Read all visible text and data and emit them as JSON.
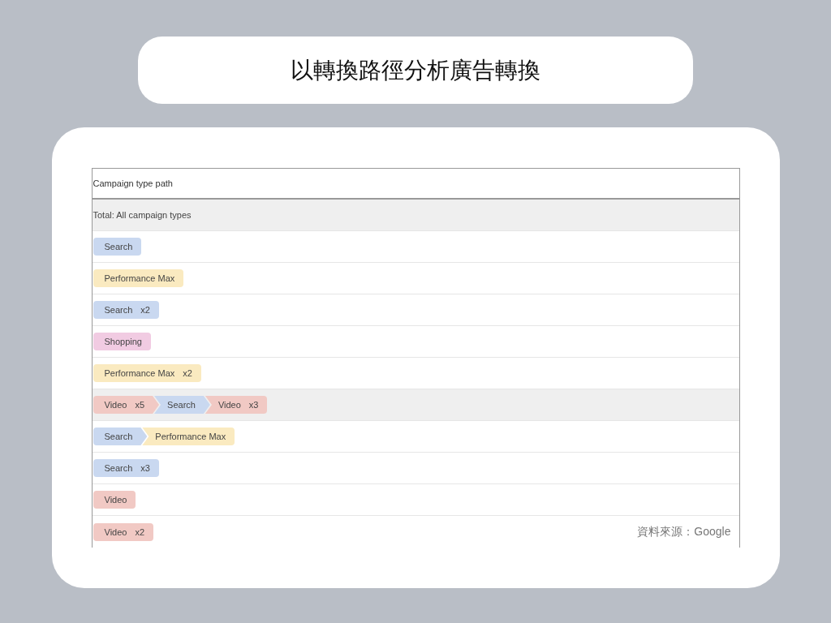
{
  "title": "以轉換路徑分析廣告轉換",
  "table": {
    "columns": [
      "Campaign type path"
    ],
    "rows": [
      {
        "kind": "total",
        "text": "Total: All campaign types",
        "shaded": true
      },
      {
        "kind": "path",
        "shaded": false,
        "segments": [
          {
            "label": "Search",
            "color": "#c9d8f0"
          }
        ]
      },
      {
        "kind": "path",
        "shaded": false,
        "segments": [
          {
            "label": "Performance Max",
            "color": "#faeac0"
          }
        ]
      },
      {
        "kind": "path",
        "shaded": false,
        "segments": [
          {
            "label": "Search",
            "count": "x2",
            "color": "#c9d8f0"
          }
        ]
      },
      {
        "kind": "path",
        "shaded": false,
        "segments": [
          {
            "label": "Shopping",
            "color": "#f1cbe2"
          }
        ]
      },
      {
        "kind": "path",
        "shaded": false,
        "segments": [
          {
            "label": "Performance Max",
            "count": "x2",
            "color": "#faeac0"
          }
        ]
      },
      {
        "kind": "path",
        "shaded": true,
        "segments": [
          {
            "label": "Video",
            "count": "x5",
            "color": "#f1c9c4"
          },
          {
            "label": "Search",
            "color": "#c9d8f0"
          },
          {
            "label": "Video",
            "count": "x3",
            "color": "#f1c9c4"
          }
        ]
      },
      {
        "kind": "path",
        "shaded": false,
        "segments": [
          {
            "label": "Search",
            "color": "#c9d8f0"
          },
          {
            "label": "Performance Max",
            "color": "#faeac0"
          }
        ]
      },
      {
        "kind": "path",
        "shaded": false,
        "segments": [
          {
            "label": "Search",
            "count": "x3",
            "color": "#c9d8f0"
          }
        ]
      },
      {
        "kind": "path",
        "shaded": false,
        "segments": [
          {
            "label": "Video",
            "color": "#f1c9c4"
          }
        ]
      },
      {
        "kind": "path",
        "shaded": false,
        "segments": [
          {
            "label": "Video",
            "count": "x2",
            "color": "#f1c9c4"
          }
        ]
      }
    ]
  },
  "source": "資料來源：Google"
}
